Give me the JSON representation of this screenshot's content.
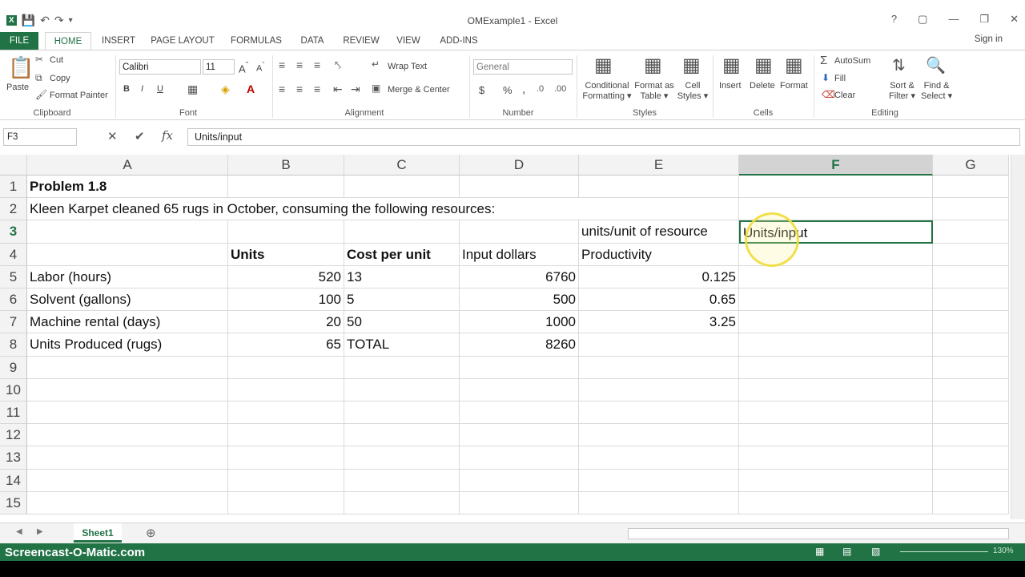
{
  "window": {
    "title": "OMExample1 - Excel",
    "help": "?",
    "sign_in": "Sign in"
  },
  "ribbon_tabs": [
    "FILE",
    "HOME",
    "INSERT",
    "PAGE LAYOUT",
    "FORMULAS",
    "DATA",
    "REVIEW",
    "VIEW",
    "ADD-INS"
  ],
  "clipboard": {
    "paste": "Paste",
    "cut": "Cut",
    "copy": "Copy",
    "format_painter": "Format Painter",
    "label": "Clipboard"
  },
  "font": {
    "name": "Calibri",
    "size": "11",
    "bold": "B",
    "italic": "I",
    "underline": "U",
    "label": "Font"
  },
  "alignment": {
    "wrap_text": "Wrap Text",
    "merge_center": "Merge & Center",
    "label": "Alignment"
  },
  "number": {
    "format": "General",
    "currency": "$",
    "percent": "%",
    "comma": ",",
    "label": "Number"
  },
  "styles": {
    "conditional": "Conditional",
    "conditional2": "Formatting",
    "format_as": "Format as",
    "format_as2": "Table",
    "cell": "Cell",
    "cell2": "Styles",
    "label": "Styles"
  },
  "cells": {
    "insert": "Insert",
    "delete": "Delete",
    "format": "Format",
    "label": "Cells"
  },
  "editing": {
    "autosum": "AutoSum",
    "fill": "Fill",
    "clear": "Clear",
    "sort": "Sort &",
    "sort2": "Filter",
    "find": "Find &",
    "find2": "Select",
    "label": "Editing"
  },
  "formula_bar": {
    "name_box": "F3",
    "content": "Units/input"
  },
  "columns": [
    "A",
    "B",
    "C",
    "D",
    "E",
    "F",
    "G"
  ],
  "rows": [
    "1",
    "2",
    "3",
    "4",
    "5",
    "6",
    "7",
    "8",
    "9",
    "10",
    "11",
    "12",
    "13",
    "14",
    "15"
  ],
  "cells_data": {
    "A1": "Problem 1.8",
    "A2": "Kleen Karpet cleaned 65 rugs in October, consuming the following resources:",
    "E3": "units/unit of resource",
    "F3": "Units/input",
    "B4": "Units",
    "C4": "Cost per unit",
    "D4": "Input dollars",
    "E4": "Productivity",
    "A5": "Labor (hours)",
    "B5": "520",
    "C5": "13",
    "D5": "6760",
    "E5": "0.125",
    "A6": "Solvent (gallons)",
    "B6": "100",
    "C6": "5",
    "D6": "500",
    "E6": "0.65",
    "A7": "Machine rental (days)",
    "B7": "20",
    "C7": "50",
    "D7": "1000",
    "E7": "3.25",
    "A8": "Units Produced (rugs)",
    "B8": "65",
    "C8": "TOTAL",
    "D8": "8260"
  },
  "sheet_tab": "Sheet1",
  "status": {
    "watermark": "Screencast-O-Matic.com",
    "zoom": "130%"
  },
  "colors": {
    "accent": "#217346"
  }
}
